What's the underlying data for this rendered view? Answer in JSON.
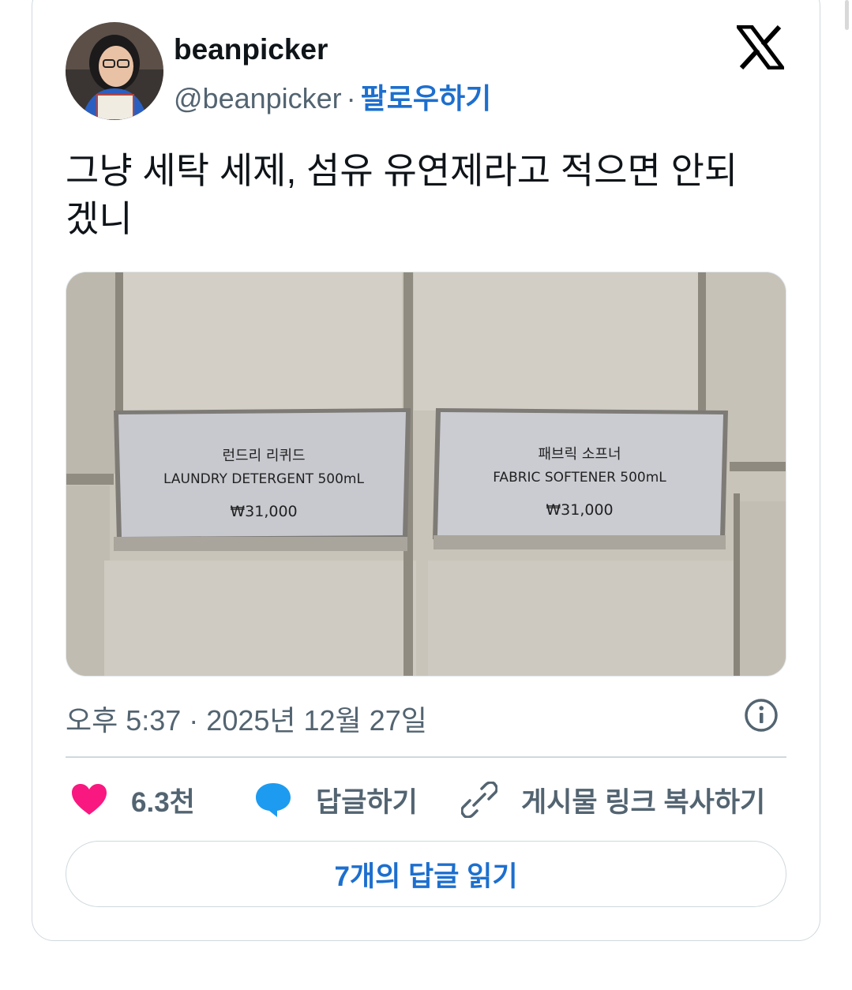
{
  "tweet": {
    "display_name": "beanpicker",
    "handle": "@beanpicker",
    "separator": "·",
    "follow_label": "팔로우하기",
    "text_line1": "그냥 세탁 세제, 섬유 유연제라고 적으면 안되",
    "text_line2": "겠니",
    "timestamp": "오후 5:37 · 2025년 12월 27일"
  },
  "photo": {
    "sign_left": {
      "korean": "런드리 리퀴드",
      "english": "LAUNDRY DETERGENT 500mL",
      "price": "₩31,000"
    },
    "sign_right": {
      "korean": "패브릭 소프너",
      "english": "FABRIC SOFTENER 500mL",
      "price": "₩31,000"
    }
  },
  "actions": {
    "like_count": "6.3천",
    "reply_label": "답글하기",
    "copy_link_label": "게시물 링크 복사하기"
  },
  "read_replies_label": "7개의 답글 읽기",
  "colors": {
    "link_blue": "#1d6fce",
    "heart_pink": "#f91880",
    "reply_blue": "#1d9bf0",
    "muted_text": "#536471",
    "border": "#cfd9de"
  },
  "icons": [
    "x-logo-icon",
    "info-icon",
    "heart-icon",
    "reply-bubble-icon",
    "link-icon"
  ]
}
